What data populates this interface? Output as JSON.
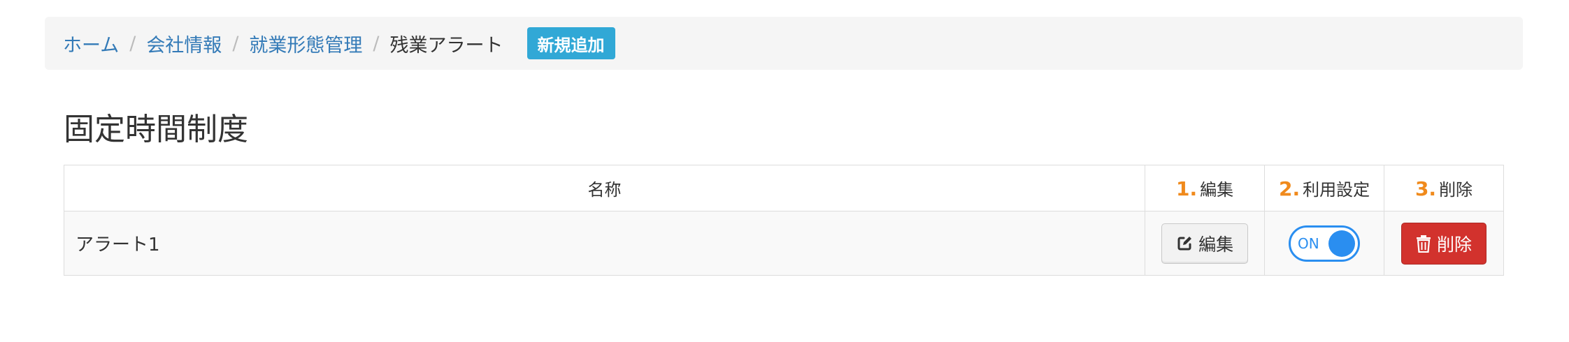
{
  "breadcrumb": {
    "items": [
      {
        "label": "ホーム"
      },
      {
        "label": "会社情報"
      },
      {
        "label": "就業形態管理"
      }
    ],
    "separator": "/",
    "current": "残業アラート",
    "new_button_label": "新規追加"
  },
  "page_title": "固定時間制度",
  "table": {
    "headers": {
      "name": "名称",
      "edit_num": "1.",
      "edit": "編集",
      "use_num": "2.",
      "use": "利用設定",
      "delete_num": "3.",
      "delete": "削除"
    },
    "rows": [
      {
        "name": "アラート1",
        "edit_label": "編集",
        "toggle_label": "ON",
        "toggle_state": true,
        "delete_label": "削除"
      }
    ]
  },
  "icons": {
    "edit": "edit-icon",
    "delete": "trash-icon"
  },
  "colors": {
    "link": "#337ab7",
    "new_button": "#31a8d6",
    "step_number": "#f08a1c",
    "toggle": "#2a8ef0",
    "delete_button": "#d2322d"
  }
}
